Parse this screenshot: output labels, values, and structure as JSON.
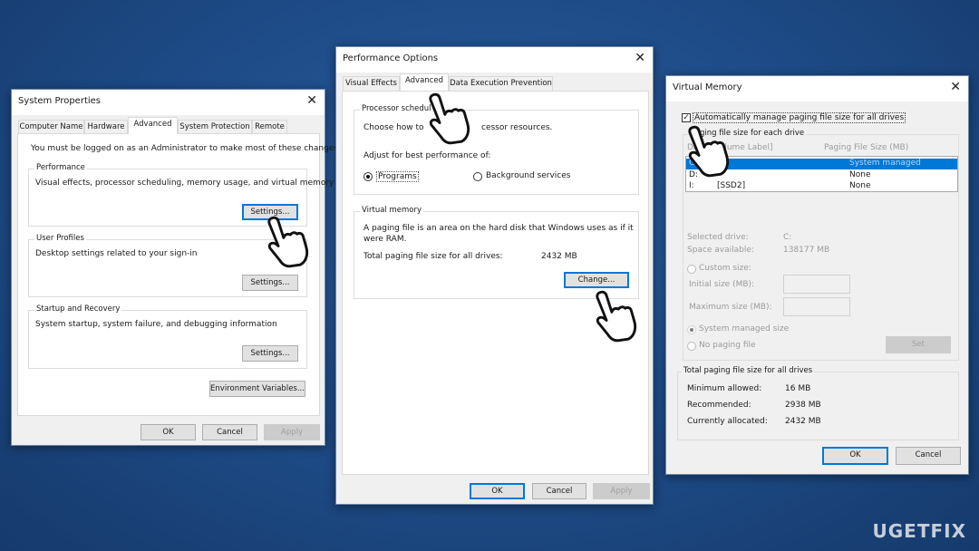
{
  "system_properties": {
    "title": "System Properties",
    "tabs": [
      "Computer Name",
      "Hardware",
      "Advanced",
      "System Protection",
      "Remote"
    ],
    "active_tab": "Advanced",
    "admin_note": "You must be logged on as an Administrator to make most of these changes.",
    "performance": {
      "label": "Performance",
      "desc": "Visual effects, processor scheduling, memory usage, and virtual memory",
      "button": "Settings..."
    },
    "user_profiles": {
      "label": "User Profiles",
      "desc": "Desktop settings related to your sign-in",
      "button": "Settings..."
    },
    "startup": {
      "label": "Startup and Recovery",
      "desc": "System startup, system failure, and debugging information",
      "button": "Settings..."
    },
    "env_button": "Environment Variables...",
    "ok": "OK",
    "cancel": "Cancel",
    "apply": "Apply"
  },
  "performance_options": {
    "title": "Performance Options",
    "tabs": [
      "Visual Effects",
      "Advanced",
      "Data Execution Prevention"
    ],
    "active_tab": "Advanced",
    "processor": {
      "label": "Processor schedul",
      "desc_left": "Choose how to",
      "desc_right": "cessor resources.",
      "adjust": "Adjust for best performance of:",
      "programs": "Programs",
      "background": "Background services",
      "selected": "Programs"
    },
    "virtual_memory": {
      "label": "Virtual memory",
      "desc1": "A paging file is an area on the hard disk that Windows uses as if it",
      "desc2": "were RAM.",
      "total_label": "Total paging file size for all drives:",
      "total_value": "2432 MB",
      "button": "Change..."
    },
    "ok": "OK",
    "cancel": "Cancel",
    "apply": "Apply"
  },
  "virtual_memory": {
    "title": "Virtual Memory",
    "auto_manage": "Automatically manage paging file size for all drives",
    "auto_manage_checked": true,
    "group_label": "Paging file size for each drive",
    "col_drive": "Drive [Volume Label]",
    "col_size": "Paging File Size (MB)",
    "drives": [
      {
        "drive": "C:",
        "label": "",
        "size": "System managed",
        "selected": true
      },
      {
        "drive": "D:",
        "label": "",
        "size": "None"
      },
      {
        "drive": "I:",
        "label": "[SSD2]",
        "size": "None"
      }
    ],
    "selected_drive_label": "Selected drive:",
    "selected_drive": "C:",
    "space_label": "Space available:",
    "space": "138177 MB",
    "custom_size": "Custom size:",
    "initial_size": "Initial size (MB):",
    "maximum_size": "Maximum size (MB):",
    "system_managed": "System managed size",
    "no_paging": "No paging file",
    "set": "Set",
    "totals_label": "Total paging file size for all drives",
    "min_label": "Minimum allowed:",
    "min": "16 MB",
    "rec_label": "Recommended:",
    "rec": "2938 MB",
    "cur_label": "Currently allocated:",
    "cur": "2432 MB",
    "ok": "OK",
    "cancel": "Cancel"
  },
  "watermark": "UGETFIX",
  "colors": {
    "background": "#1d4a85",
    "selection": "#0078d7",
    "accent": "#0078d7"
  }
}
